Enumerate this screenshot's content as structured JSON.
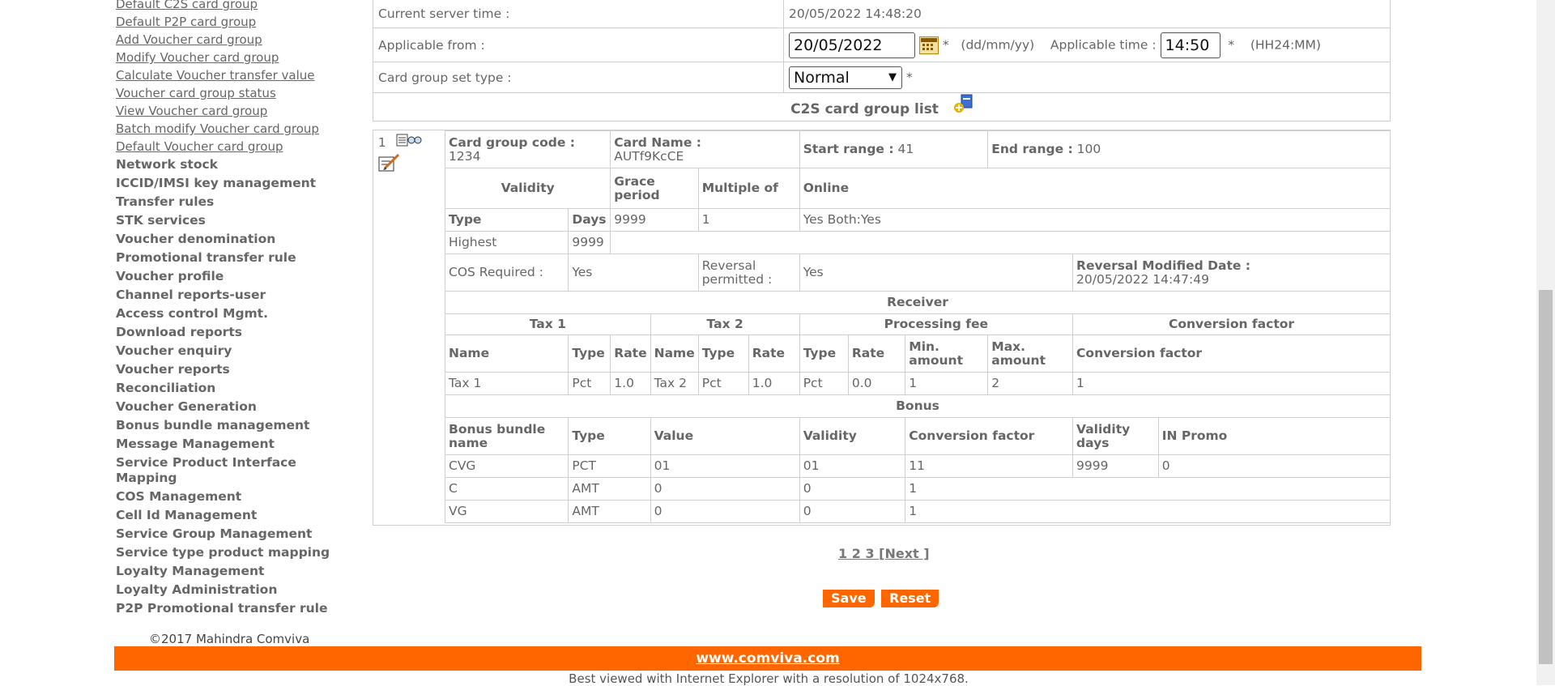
{
  "sidebar": {
    "links": [
      "Default C2S card group",
      "Default P2P card group",
      "Add Voucher card group",
      "Modify Voucher card group",
      "Calculate Voucher transfer value",
      "Voucher card group status",
      "View Voucher card group",
      "Batch modify Voucher card group",
      "Default Voucher card group"
    ],
    "sections": [
      "Network stock",
      "ICCID/IMSI key management",
      "Transfer rules",
      "STK services",
      "Voucher denomination",
      "Promotional transfer rule",
      "Voucher profile",
      "Channel reports-user",
      "Access control Mgmt.",
      "Download reports",
      "Voucher enquiry",
      "Voucher reports",
      "Reconciliation",
      "Voucher Generation",
      "Bonus bundle management",
      "Message Management",
      "Service Product Interface Mapping",
      "COS Management",
      "Cell Id Management",
      "Service Group Management",
      "Service type product mapping",
      "Loyalty Management",
      "Loyalty Administration",
      "P2P Promotional transfer rule"
    ]
  },
  "form": {
    "server_time_label": "Current server time :",
    "server_time_value": "20/05/2022 14:48:20",
    "applicable_from_label": "Applicable from :",
    "applicable_from_value": "20/05/2022",
    "required_mark": "*",
    "date_hint": "(dd/mm/yy)",
    "applicable_time_label": "Applicable time :",
    "applicable_time_value": "14:50",
    "time_hint": "(HH24:MM)",
    "set_type_label": "Card group set type :",
    "set_type_value": "Normal",
    "list_header": "C2S card group list"
  },
  "card": {
    "index": "1",
    "code_label": "Card group code :",
    "code_value": "1234",
    "name_label": "Card Name :",
    "name_value": "AUTf9KcCE",
    "start_label": "Start range :",
    "start_value": "41",
    "end_label": "End range :",
    "end_value": "100",
    "validity": "Validity",
    "grace_period": "Grace period",
    "multiple_of": "Multiple of",
    "online": "Online",
    "type_h": "Type",
    "days_h": "Days",
    "grace_value": "9999",
    "multiple_value": "1",
    "online_value": "Yes Both:Yes",
    "highest": "Highest",
    "highest_days": "9999",
    "cos_label": "COS Required :",
    "cos_value": "Yes",
    "reversal_label": "Reversal permitted :",
    "reversal_value": "Yes",
    "rev_date_label": "Reversal Modified Date :",
    "rev_date_value": "20/05/2022 14:47:49",
    "receiver": "Receiver",
    "tax1": "Tax 1",
    "tax2": "Tax 2",
    "processing_fee": "Processing fee",
    "conversion_factor": "Conversion factor",
    "name_h": "Name",
    "rate_h": "Rate",
    "min_amount": "Min. amount",
    "max_amount": "Max. amount",
    "tax_row": [
      "Tax 1",
      "Pct",
      "1.0",
      "Tax 2",
      "Pct",
      "1.0",
      "Pct",
      "0.0",
      "1",
      "2",
      "1"
    ],
    "bonus": "Bonus",
    "bonus_headers": [
      "Bonus bundle name",
      "Type",
      "Value",
      "Validity",
      "Conversion factor",
      "Validity days",
      "IN Promo"
    ],
    "bonus_rows": [
      [
        "CVG",
        "PCT",
        "01",
        "01",
        "11",
        "9999",
        "0"
      ],
      [
        "C",
        "AMT",
        "0",
        "0",
        "1",
        "",
        ""
      ],
      [
        "VG",
        "AMT",
        "0",
        "0",
        "1",
        "",
        ""
      ]
    ]
  },
  "pager": {
    "p1": "1",
    "p2": "2",
    "p3": "3",
    "next": "[Next ]"
  },
  "buttons": {
    "save": "Save",
    "reset": "Reset"
  },
  "footer": {
    "copyright": "©2017 Mahindra Comviva",
    "site": "www.comviva.com",
    "note": "Best viewed with Internet Explorer with a resolution of 1024x768."
  },
  "colors": {
    "accent": "#ff6600"
  }
}
